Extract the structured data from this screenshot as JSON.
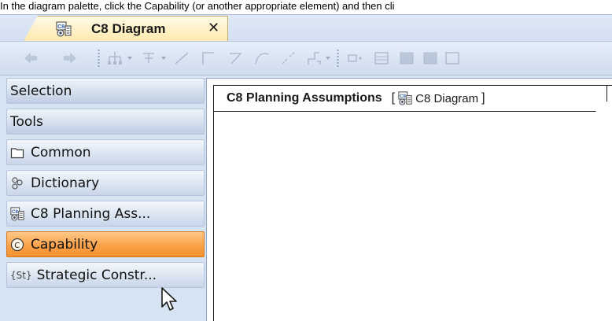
{
  "instruction": "In the diagram palette, click the Capability (or another appropriate element) and then cli",
  "tab": {
    "label": "C8 Diagram",
    "close": "✕",
    "icon": "c8-diagram-icon"
  },
  "toolbar": {
    "icons": [
      "back-arrow-icon",
      "forward-arrow-icon",
      "layout-tree-icon",
      "layout-hierarchy-icon",
      "line-straight-icon",
      "line-orthogonal-icon",
      "line-rectilinear-icon",
      "line-bezier-icon",
      "line-oblique-icon",
      "line-route-icon",
      "insert-icon",
      "grid-icon",
      "fill-icon"
    ]
  },
  "palette": {
    "items": [
      {
        "label": "Selection",
        "kind": "header"
      },
      {
        "label": "Tools",
        "kind": "header"
      },
      {
        "label": "Common",
        "kind": "group",
        "icon": "folder-icon"
      },
      {
        "label": "Dictionary",
        "kind": "group",
        "icon": "dictionary-icon"
      },
      {
        "label": "C8 Planning Ass...",
        "kind": "tool",
        "icon": "c8-diagram-icon"
      },
      {
        "label": "Capability",
        "kind": "tool",
        "icon": "capability-icon",
        "selected": true
      },
      {
        "label": "Strategic Constr...",
        "kind": "tool",
        "icon": "strategic-constraint-icon",
        "icon_text": "{St}"
      }
    ]
  },
  "diagram": {
    "name": "C8 Planning Assumptions",
    "open_bracket": "[",
    "type": "C8 Diagram",
    "close_bracket": "]"
  },
  "colors": {
    "selected_item": "#f8a043",
    "app_background": "#d6e3f3",
    "tab_active": "#ffe9ad"
  }
}
